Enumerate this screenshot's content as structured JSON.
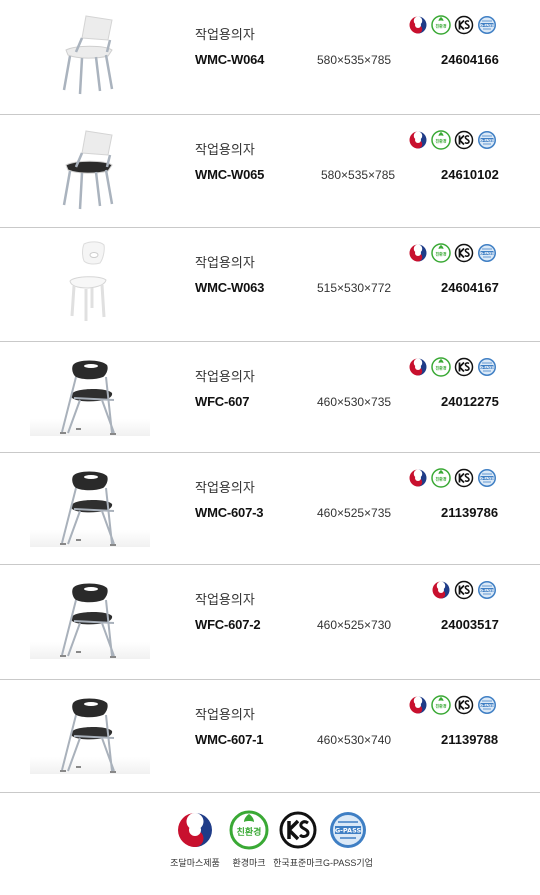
{
  "products": [
    {
      "category": "작업용의자",
      "model": "WMC-W064",
      "dims": "580×535×785",
      "code": "24604166",
      "marks": [
        "taegeuk-icon",
        "eco-label-icon",
        "ks-icon",
        "gpass-icon"
      ],
      "chair": "white-plastic-seat"
    },
    {
      "category": "작업용의자",
      "model": "WMC-W065",
      "dims": "580×535×785",
      "code": "24610102",
      "marks": [
        "taegeuk-icon",
        "eco-label-icon",
        "ks-icon",
        "gpass-icon"
      ],
      "chair": "white-with-black-cushion"
    },
    {
      "category": "작업용의자",
      "model": "WMC-W063",
      "dims": "515×530×772",
      "code": "24604167",
      "marks": [
        "taegeuk-icon",
        "eco-label-icon",
        "ks-icon",
        "gpass-icon"
      ],
      "chair": "white-all"
    },
    {
      "category": "작업용의자",
      "model": "WFC-607",
      "dims": "460×530×735",
      "code": "24012275",
      "marks": [
        "taegeuk-icon",
        "eco-label-icon",
        "ks-icon",
        "gpass-icon"
      ],
      "chair": "black-folding"
    },
    {
      "category": "작업용의자",
      "model": "WMC-607-3",
      "dims": "460×525×735",
      "code": "21139786",
      "marks": [
        "taegeuk-icon",
        "eco-label-icon",
        "ks-icon",
        "gpass-icon"
      ],
      "chair": "black-folding"
    },
    {
      "category": "작업용의자",
      "model": "WFC-607-2",
      "dims": "460×525×730",
      "code": "24003517",
      "marks": [
        "taegeuk-icon",
        "ks-icon",
        "gpass-icon"
      ],
      "chair": "black-folding"
    },
    {
      "category": "작업용의자",
      "model": "WMC-607-1",
      "dims": "460×530×740",
      "code": "21139788",
      "marks": [
        "taegeuk-icon",
        "eco-label-icon",
        "ks-icon",
        "gpass-icon"
      ],
      "chair": "black-folding"
    }
  ],
  "legend": [
    {
      "icon": "taegeuk-icon",
      "label": "조달마스제품"
    },
    {
      "icon": "eco-label-icon",
      "label": "환경마크"
    },
    {
      "icon": "ks-icon",
      "label": "한국표준마크"
    },
    {
      "icon": "gpass-icon",
      "label": "G-PASS기업"
    }
  ],
  "eco_text": "친환경",
  "gpass_text": "G-PASS",
  "colors": {
    "taegeuk_red": "#c8102e",
    "taegeuk_blue": "#1f3c88",
    "eco_green": "#3aa935",
    "gpass_blue": "#3f7fc4",
    "divider": "#c9c9c9"
  }
}
